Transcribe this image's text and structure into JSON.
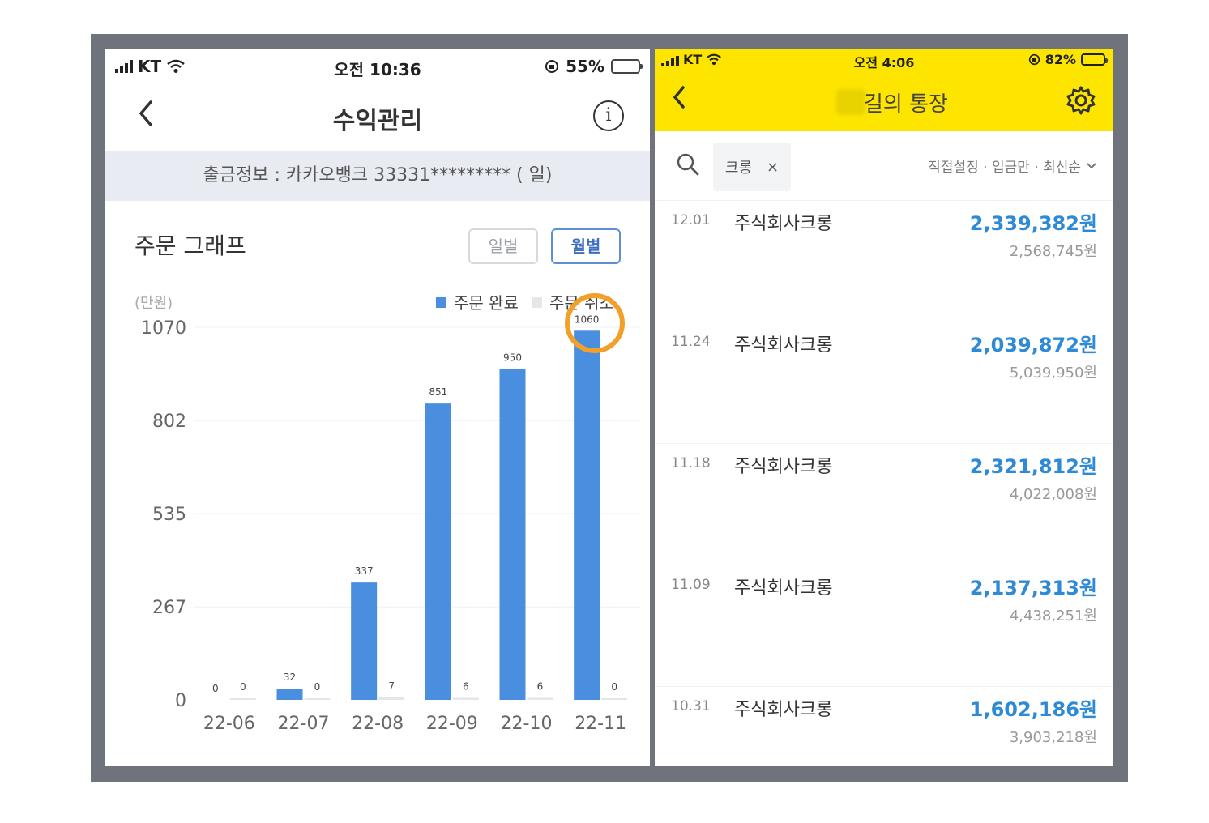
{
  "left": {
    "status": {
      "carrier": "KT",
      "time": "오전 10:36",
      "battery": "55%",
      "battery_level": 0.55
    },
    "header": {
      "back_icon": "chevron-left-icon",
      "title": "수익관리",
      "info_icon": "info-icon",
      "info_glyph": "i"
    },
    "payout_info": "출금정보 : 카카오뱅크 33331********* (       일)",
    "chart_title": "주문 그래프",
    "toggle": {
      "daily": "일별",
      "monthly": "월별",
      "selected": "monthly"
    },
    "chart_data": {
      "type": "bar",
      "title": "",
      "ylabel": "(만원)",
      "ylim": [
        0,
        1070
      ],
      "yticks": [
        0,
        267,
        535,
        802,
        1070
      ],
      "categories": [
        "22-06",
        "22-07",
        "22-08",
        "22-09",
        "22-10",
        "22-11"
      ],
      "legend_position": "top-right",
      "grid": true,
      "series": [
        {
          "name": "주문 완료",
          "color": "#4a8ee0",
          "values": [
            0,
            32,
            337,
            851,
            950,
            1060
          ]
        },
        {
          "name": "주문 취소",
          "color": "#e4e6ea",
          "values": [
            0,
            0,
            7,
            6,
            6,
            0
          ]
        }
      ]
    }
  },
  "right": {
    "status": {
      "carrier": "KT",
      "time": "오전 4:06",
      "battery": "82%",
      "battery_level": 0.82
    },
    "header": {
      "back_icon": "chevron-left-icon",
      "title": "길의 통장",
      "settings_icon": "gear-icon",
      "bg_color": "#fde500"
    },
    "search": {
      "icon": "search-icon",
      "chip_label": "크롱",
      "chip_close": "×",
      "filter_label": "직접설정 · 입금만 · 최신순"
    },
    "transactions": [
      {
        "date": "12.01",
        "name": "주식회사크롱",
        "amount": "2,339,382원",
        "balance": "2,568,745원"
      },
      {
        "date": "11.24",
        "name": "주식회사크롱",
        "amount": "2,039,872원",
        "balance": "5,039,950원"
      },
      {
        "date": "11.18",
        "name": "주식회사크롱",
        "amount": "2,321,812원",
        "balance": "4,022,008원"
      },
      {
        "date": "11.09",
        "name": "주식회사크롱",
        "amount": "2,137,313원",
        "balance": "4,438,251원"
      },
      {
        "date": "10.31",
        "name": "주식회사크롱",
        "amount": "1,602,186원",
        "balance": "3,903,218원"
      }
    ]
  }
}
